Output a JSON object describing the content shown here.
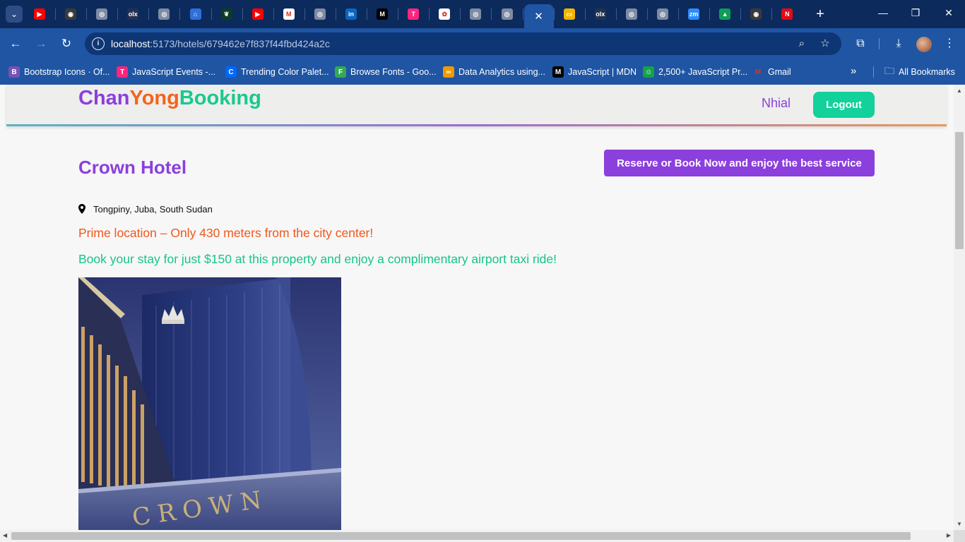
{
  "browser": {
    "url_host": "localhost",
    "url_path": ":5173/hotels/679462e7f837f44fbd424a2c",
    "tabs": [
      {
        "icon": "youtube-icon",
        "color": "#ff0000",
        "glyph": "▶"
      },
      {
        "icon": "github-icon",
        "color": "#3a3a3a",
        "glyph": "◉"
      },
      {
        "icon": "globe-icon",
        "color": "#7d8ba3",
        "glyph": "◎"
      },
      {
        "icon": "olx-icon",
        "color": "#23314f",
        "glyph": "olx"
      },
      {
        "icon": "globe-icon",
        "color": "#7d8ba3",
        "glyph": "◎"
      },
      {
        "icon": "dashboard-icon",
        "color": "#2f6fd8",
        "glyph": "⌂"
      },
      {
        "icon": "mongodb-leaf-icon",
        "color": "#0b3d26",
        "glyph": "❦"
      },
      {
        "icon": "youtube-icon",
        "color": "#ff0000",
        "glyph": "▶"
      },
      {
        "icon": "gmail-icon",
        "color": "#ffffff",
        "glyph": "M"
      },
      {
        "icon": "globe-icon",
        "color": "#7d8ba3",
        "glyph": "◎"
      },
      {
        "icon": "linkedin-icon",
        "color": "#0a66c2",
        "glyph": "in"
      },
      {
        "icon": "medium-icon",
        "color": "#000000",
        "glyph": "M"
      },
      {
        "icon": "tinder-icon",
        "color": "#fd267d",
        "glyph": "T"
      },
      {
        "icon": "chatgpt-icon",
        "color": "#ffffff",
        "glyph": "✿"
      },
      {
        "icon": "globe-icon",
        "color": "#7d8ba3",
        "glyph": "◎"
      },
      {
        "icon": "globe-icon",
        "color": "#7d8ba3",
        "glyph": "◎"
      },
      {
        "icon": "close-icon",
        "color": "#1f55a3",
        "glyph": "✕"
      },
      {
        "icon": "google-slides-icon",
        "color": "#f4b400",
        "glyph": "▭"
      },
      {
        "icon": "olx-icon",
        "color": "#23314f",
        "glyph": "olx"
      },
      {
        "icon": "globe-icon",
        "color": "#7d8ba3",
        "glyph": "◎"
      },
      {
        "icon": "globe-icon",
        "color": "#7d8ba3",
        "glyph": "◎"
      },
      {
        "icon": "zoom-icon",
        "color": "#2d8cff",
        "glyph": "zm"
      },
      {
        "icon": "google-drive-icon",
        "color": "#0f9d58",
        "glyph": "▲"
      },
      {
        "icon": "github-icon",
        "color": "#3a3a3a",
        "glyph": "◉"
      },
      {
        "icon": "netflix-icon",
        "color": "#e50914",
        "glyph": "N"
      }
    ],
    "bookmarks": [
      {
        "label": "Bootstrap Icons · Of...",
        "icon": "bootstrap-icon",
        "color": "#7952b3",
        "glyph": "B"
      },
      {
        "label": "JavaScript Events -...",
        "icon": "tinder-icon",
        "color": "#fd267d",
        "glyph": "T"
      },
      {
        "label": "Trending Color Palet...",
        "icon": "coolors-icon",
        "color": "#0066ff",
        "glyph": "C"
      },
      {
        "label": "Browse Fonts - Goo...",
        "icon": "google-fonts-icon",
        "color": "#34a853",
        "glyph": "F"
      },
      {
        "label": "Data Analytics using...",
        "icon": "infinity-icon",
        "color": "#f29900",
        "glyph": "∞"
      },
      {
        "label": "JavaScript | MDN",
        "icon": "mdn-icon",
        "color": "#000000",
        "glyph": "M"
      },
      {
        "label": "2,500+ JavaScript Pr...",
        "icon": "exercism-icon",
        "color": "#15a34a",
        "glyph": "☺"
      },
      {
        "label": "Gmail",
        "icon": "gmail-icon",
        "color": "#ffffff",
        "glyph": "M"
      }
    ],
    "all_bookmarks": "All Bookmarks"
  },
  "site": {
    "logo_part1": "Chan",
    "logo_part2": "Yong",
    "logo_part3": "Booking",
    "username": "Nhial",
    "logout_label": "Logout"
  },
  "hotel": {
    "name": "Crown Hotel",
    "book_button": "Reserve or Book Now and enjoy the best service",
    "address": "Tongpiny, Juba, South Sudan",
    "promo_location": "Prime location – Only 430 meters from the city center!",
    "promo_price": "Book your stay for just $150 at this property and enjoy a complimentary airport taxi ride!",
    "photo_sign": "CROWN"
  },
  "colors": {
    "brand_purple": "#8b3fdc",
    "brand_orange": "#f4641e",
    "brand_green": "#18c98f",
    "browser_blue": "#1f55a3"
  }
}
